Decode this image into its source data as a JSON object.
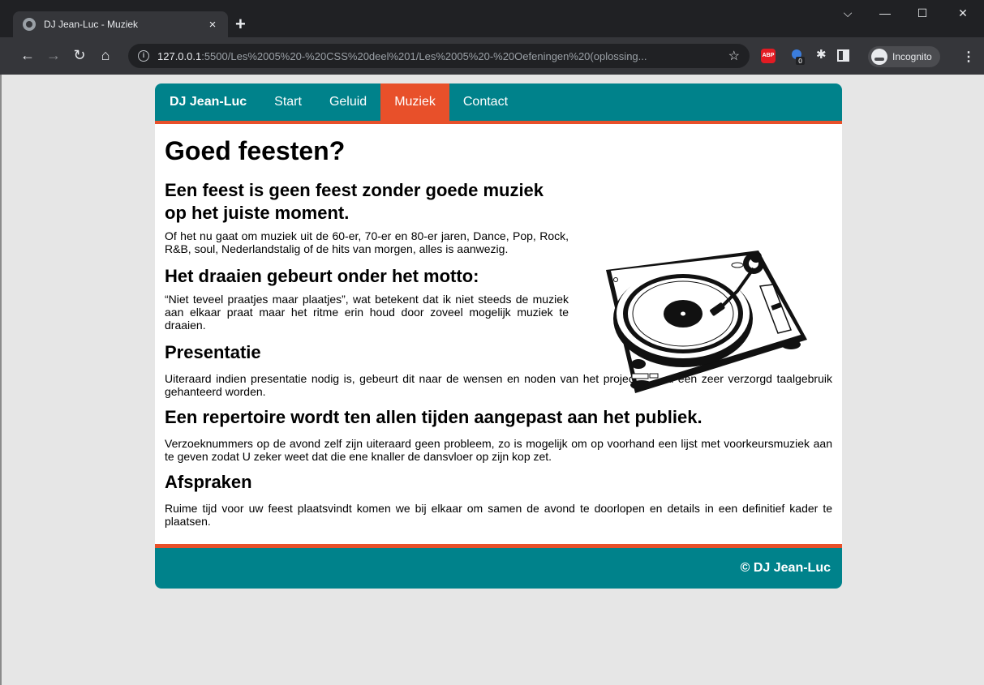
{
  "browser": {
    "tab_title": "DJ Jean-Luc - Muziek",
    "tab_close": "×",
    "new_tab": "+",
    "url_host": "127.0.0.1",
    "url_path": ":5500/Les%2005%20-%20CSS%20deel%201/Les%2005%20-%20Oefeningen%20(oplossing...",
    "incognito_label": "Incognito",
    "extensions": [
      "adblock-plus-icon",
      "badge-extension-icon",
      "extensions-puzzle-icon",
      "side-panel-icon"
    ]
  },
  "site": {
    "nav": [
      {
        "label": "DJ Jean-Luc",
        "active": false
      },
      {
        "label": "Start",
        "active": false
      },
      {
        "label": "Geluid",
        "active": false
      },
      {
        "label": "Muziek",
        "active": true
      },
      {
        "label": "Contact",
        "active": false
      }
    ],
    "colors": {
      "teal": "#00828b",
      "orange": "#e8502a"
    },
    "title": "Goed feesten?",
    "intro": {
      "heading1": "Een feest is geen feest zonder goede muziek op het juiste moment.",
      "para1": "Of het nu gaat om muziek uit de 60-er, 70-er en 80-er jaren, Dance, Pop, Rock, R&B, soul, Nederlandstalig of de hits van morgen, alles is aanwezig.",
      "heading2": "Het draaien gebeurt onder het motto:",
      "para2": "“Niet teveel praatjes maar plaatjes”, wat betekent dat ik niet steeds de muziek aan elkaar praat maar het ritme erin houd door zoveel mogelijk muziek te draaien."
    },
    "sections": [
      {
        "heading": "Presentatie",
        "text": "Uiteraard indien presentatie nodig is, gebeurt dit naar de wensen en noden van het project en zal een zeer verzorgd taalgebruik gehanteerd worden."
      },
      {
        "heading": "Een repertoire wordt ten allen tijden aangepast aan het publiek.",
        "text": "Verzoeknummers op de avond zelf zijn uiteraard geen probleem, zo is mogelijk om op voorhand een lijst met voorkeursmuziek aan te geven zodat U zeker weet dat die ene knaller de dansvloer op zijn kop zet."
      },
      {
        "heading": "Afspraken",
        "text": "Ruime tijd voor uw feest plaatsvindt komen we bij elkaar om samen de avond te doorlopen en details in een definitief kader te plaatsen."
      }
    ],
    "footer": "© DJ Jean-Luc"
  }
}
